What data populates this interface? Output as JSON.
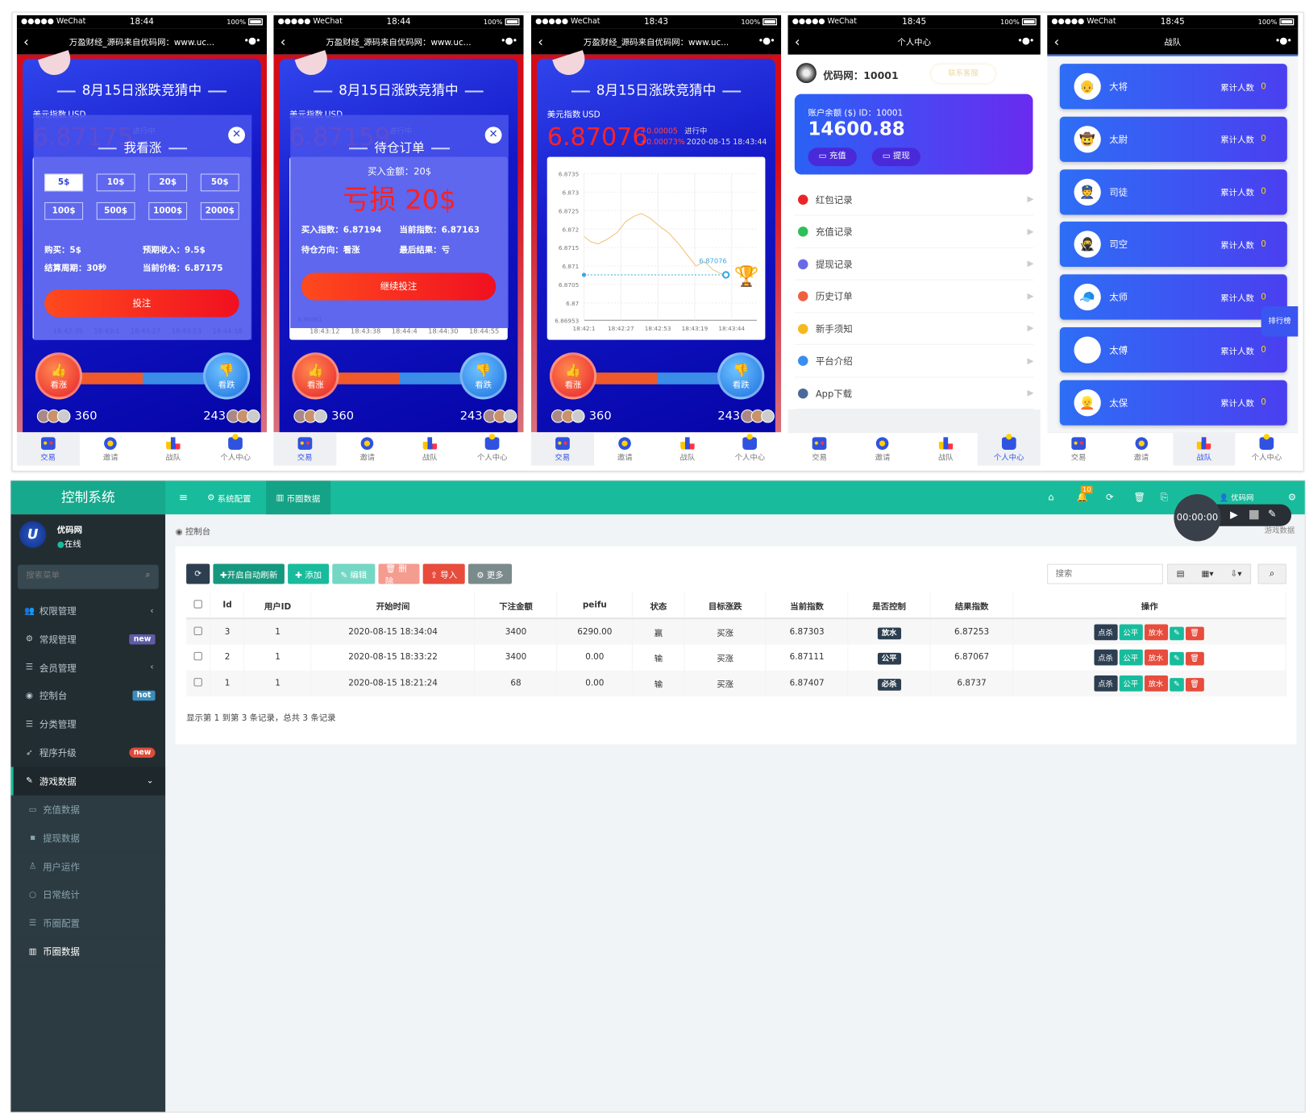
{
  "status_bar": {
    "carrier": "●●●●● WeChat",
    "battery": "100%"
  },
  "tabs": [
    "交易",
    "邀请",
    "战队",
    "个人中心"
  ],
  "game_nav_title": "万盈财经_源码来自优码网：www.uc...",
  "game": {
    "title": "8月15日涨跌竞猜中",
    "index_name": "美元指数",
    "index_unit": "USD",
    "up_label": "看涨",
    "down_label": "看跌",
    "up_count": "360",
    "down_count": "243"
  },
  "phone1": {
    "time": "18:44",
    "active_tab": 0,
    "price": "6.87175",
    "status": "进行中",
    "x_ticks": [
      "18:42:35",
      "18:43:1",
      "18:43:27",
      "18:43:53",
      "18:44:18"
    ],
    "modal": {
      "title": "我看涨",
      "amounts": [
        "5$",
        "10$",
        "20$",
        "50$",
        "100$",
        "500$",
        "1000$",
        "2000$"
      ],
      "selected": "5$",
      "buy": "购买：5$",
      "expected": "预期收入：9.5$",
      "period": "结算周期：30秒",
      "current": "当前价格：6.87175",
      "submit": "投注"
    }
  },
  "phone2": {
    "time": "18:44",
    "active_tab": 0,
    "price": "6.87159",
    "status": "进行中",
    "y_min": "6.86981",
    "x_ticks": [
      "18:43:12",
      "18:43:38",
      "18:44:4",
      "18:44:30",
      "18:44:55"
    ],
    "modal": {
      "title": "待仓订单",
      "amount": "买入金额：20$",
      "result_big": "亏损 20$",
      "buy_index": "买入指数：6.87194",
      "cur_index": "当前指数：6.87163",
      "direction": "待仓方向：看涨",
      "final": "最后结果：亏",
      "submit": "继续投注"
    }
  },
  "phone3": {
    "time": "18:43",
    "active_tab": 0,
    "price": "6.87076",
    "change": "+0.00005",
    "change_pct": "+0.00073%",
    "status": "进行中",
    "datetime": "2020-08-15 18:43:44"
  },
  "chart_data": {
    "type": "line",
    "y_ticks": [
      "6.8735",
      "6.873",
      "6.8725",
      "6.872",
      "6.8715",
      "6.871",
      "6.8705",
      "6.87",
      "6.86953"
    ],
    "ylim": [
      6.86953,
      6.8735
    ],
    "x_ticks": [
      "18:42:1",
      "18:42:27",
      "18:42:53",
      "18:43:19",
      "18:43:44"
    ],
    "x": [
      "18:42:01",
      "18:42:06",
      "18:42:11",
      "18:42:17",
      "18:42:24",
      "18:42:30",
      "18:42:36",
      "18:42:41",
      "18:42:47",
      "18:42:53",
      "18:43:00",
      "18:43:07",
      "18:43:13",
      "18:43:19",
      "18:43:25",
      "18:43:31",
      "18:43:36",
      "18:43:40"
    ],
    "values": [
      6.8718,
      6.87165,
      6.8716,
      6.87172,
      6.8719,
      6.8722,
      6.87235,
      6.87242,
      6.8723,
      6.8721,
      6.8719,
      6.8716,
      6.8713,
      6.871,
      6.87112,
      6.8709,
      6.8708,
      6.87076
    ],
    "current_label": "6.87076",
    "current_value": 6.87076,
    "line_color": "#f2c27a",
    "marker_color": "#3aa8e0"
  },
  "phone4": {
    "time": "18:45",
    "active_tab": 3,
    "nav_title": "个人中心",
    "user": "优码网：10001",
    "service": "联系客服",
    "balance_label": "账户余额 ($) ID：10001",
    "balance": "14600.88",
    "recharge": "充值",
    "withdraw": "提现",
    "menu": [
      {
        "label": "红包记录",
        "color": "#e8262a"
      },
      {
        "label": "充值记录",
        "color": "#2fbf5a"
      },
      {
        "label": "提现记录",
        "color": "#6a6ae8"
      },
      {
        "label": "历史订单",
        "color": "#f06040"
      },
      {
        "label": "新手须知",
        "color": "#f5b820"
      },
      {
        "label": "平台介绍",
        "color": "#3a8ef0"
      },
      {
        "label": "App下载",
        "color": "#4a6a9a"
      }
    ]
  },
  "phone5": {
    "time": "18:45",
    "active_tab": 2,
    "nav_title": "战队",
    "count_label": "累计人数",
    "rank_tab": "排行榜",
    "ranks": [
      {
        "name": "大将",
        "count": "0",
        "icon": "👴"
      },
      {
        "name": "太尉",
        "count": "0",
        "icon": "🤠"
      },
      {
        "name": "司徒",
        "count": "0",
        "icon": "👮"
      },
      {
        "name": "司空",
        "count": "0",
        "icon": "🥷"
      },
      {
        "name": "太师",
        "count": "0",
        "icon": "🧢"
      },
      {
        "name": "太傅",
        "count": "0",
        "icon": "😎"
      },
      {
        "name": "太保",
        "count": "0",
        "icon": "👱"
      }
    ]
  },
  "admin": {
    "logo": "控制系统",
    "user": "优码网",
    "online": "在线",
    "search_placeholder": "搜索菜单",
    "top_tabs": [
      "系统配置",
      "币圈数据"
    ],
    "top_user": "优码网",
    "notif_count": "10",
    "breadcrumb": "控制台",
    "breadcrumb_right": "游戏数据",
    "recorder_time": "00:00:00",
    "menu": [
      {
        "label": "权限管理",
        "icon": "users-icon",
        "glyph": "👥",
        "caret": "‹"
      },
      {
        "label": "常规管理",
        "icon": "cogs-icon",
        "glyph": "⚙",
        "tag": "new",
        "tag_color": "#605ca8"
      },
      {
        "label": "会员管理",
        "icon": "list-icon",
        "glyph": "☰",
        "caret": "‹"
      },
      {
        "label": "控制台",
        "icon": "dashboard-icon",
        "glyph": "◉",
        "tag": "hot",
        "tag_color": "#3c8dbc"
      },
      {
        "label": "分类管理",
        "icon": "list-icon",
        "glyph": "☰"
      },
      {
        "label": "程序升级",
        "icon": "rocket-icon",
        "glyph": "➶",
        "tag": "new",
        "tag_color": "#dd4b39"
      },
      {
        "label": "游戏数据",
        "icon": "magic-icon",
        "glyph": "✎",
        "caret": "⌄",
        "active": true
      }
    ],
    "submenu": [
      {
        "label": "充值数据",
        "glyph": "▭"
      },
      {
        "label": "提现数据",
        "glyph": "▪"
      },
      {
        "label": "用户运作",
        "glyph": "♙"
      },
      {
        "label": "日常统计",
        "glyph": "○"
      },
      {
        "label": "币圈配置",
        "glyph": "☰"
      },
      {
        "label": "币圈数据",
        "glyph": "▥",
        "active": true
      }
    ],
    "toolbar": [
      {
        "label": "",
        "icon": "refresh-icon",
        "glyph": "⟳",
        "color": "#2c3e50"
      },
      {
        "label": "✚开启自动刷新",
        "color": "#16987e"
      },
      {
        "label": "✚ 添加",
        "color": "#18bc9c"
      },
      {
        "label": "✎ 编辑",
        "color": "#74d7c3"
      },
      {
        "label": "🗑 删除",
        "color": "#f39c8f"
      },
      {
        "label": "⇪ 导入",
        "color": "#e74c3c"
      },
      {
        "label": "⚙ 更多",
        "color": "#7b8a8b"
      }
    ],
    "table_search_placeholder": "搜索",
    "columns": [
      "Id",
      "用户ID",
      "开始时间",
      "下注金额",
      "peifu",
      "状态",
      "目标涨跌",
      "当前指数",
      "是否控制",
      "结果指数",
      "操作"
    ],
    "rows": [
      [
        "3",
        "1",
        "2020-08-15 18:34:04",
        "3400",
        "6290.00",
        "赢",
        "买涨",
        "6.87303",
        "放水",
        "6.87253"
      ],
      [
        "2",
        "1",
        "2020-08-15 18:33:22",
        "3400",
        "0.00",
        "输",
        "买涨",
        "6.87111",
        "公平",
        "6.87067"
      ],
      [
        "1",
        "1",
        "2020-08-15 18:21:24",
        "68",
        "0.00",
        "输",
        "买涨",
        "6.87407",
        "必杀",
        "6.8737"
      ]
    ],
    "row_actions": [
      {
        "label": "点杀",
        "color": "#2c3e50"
      },
      {
        "label": "公平",
        "color": "#18bc9c"
      },
      {
        "label": "放水",
        "color": "#e74c3c"
      },
      {
        "label": "✎",
        "color": "#18bc9c"
      },
      {
        "label": "🗑",
        "color": "#e74c3c"
      }
    ],
    "footer": "显示第 1 到第 3 条记录，总共 3 条记录"
  }
}
